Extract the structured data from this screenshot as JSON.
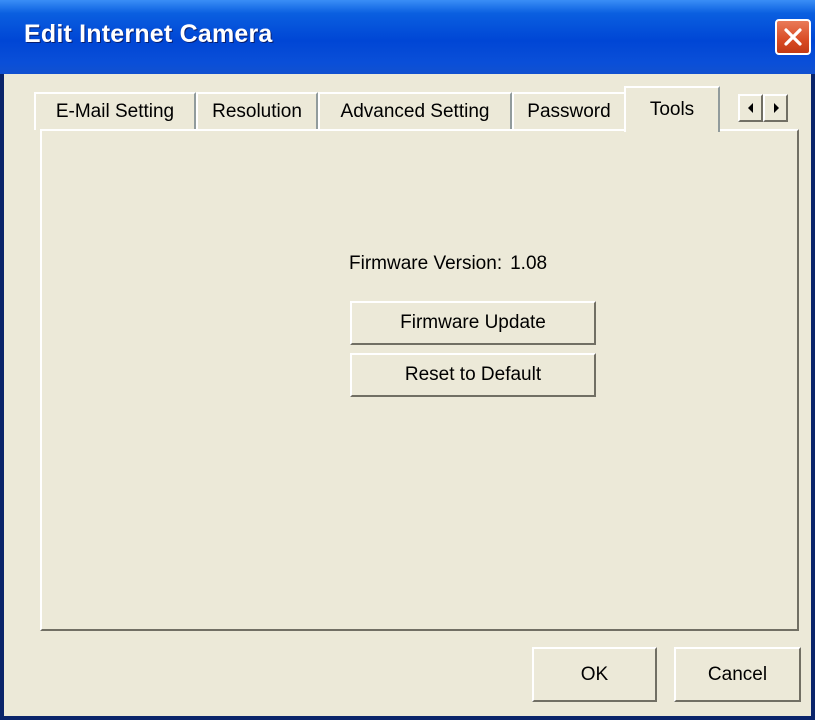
{
  "window": {
    "title": "Edit Internet Camera",
    "close_icon": "close-x-icon",
    "titlebar_color": "#0046d5",
    "close_color": "#d94b24"
  },
  "tabs": [
    {
      "label": "E-Mail Setting"
    },
    {
      "label": "Resolution"
    },
    {
      "label": "Advanced Setting"
    },
    {
      "label": "Password"
    },
    {
      "label": "Tools",
      "active": true
    }
  ],
  "tab_scroll": {
    "left_icon": "arrow-left-icon",
    "right_icon": "arrow-right-icon"
  },
  "tools": {
    "firmware_label": "Firmware Version:",
    "firmware_value": "1.08",
    "firmware_update_button": "Firmware Update",
    "reset_button": "Reset to Default"
  },
  "footer": {
    "ok_label": "OK",
    "cancel_label": "Cancel"
  }
}
